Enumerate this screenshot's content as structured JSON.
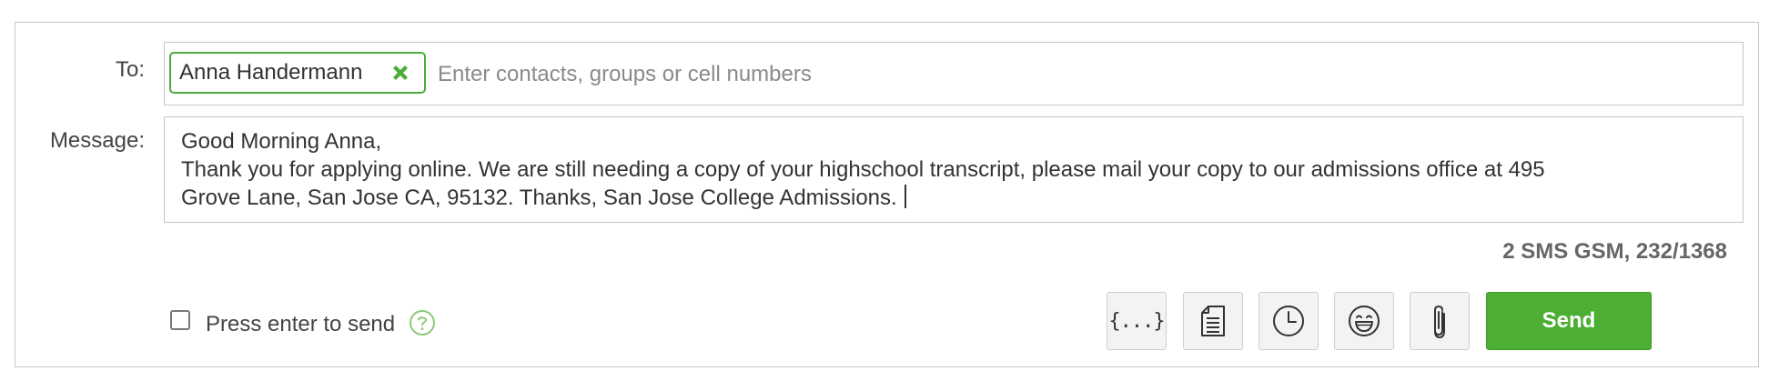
{
  "labels": {
    "to": "To:",
    "message": "Message:"
  },
  "recipients": [
    {
      "name": "Anna Handermann",
      "remove_icon": "close-x-icon"
    }
  ],
  "to_input": {
    "placeholder": "Enter contacts, groups or cell numbers",
    "value": ""
  },
  "message": {
    "lines": [
      "Good Morning Anna,",
      "Thank you for applying online. We are still needing a copy of your highschool transcript, please mail your copy to our admissions office at 495",
      "Grove Lane, San Jose CA, 95132. Thanks, San Jose College Admissions."
    ]
  },
  "counter": "2 SMS GSM, 232/1368",
  "press_enter": {
    "label": "Press enter to send",
    "checked": false,
    "help_icon": "question-circle-icon"
  },
  "toolbar": {
    "buttons": [
      {
        "icon": "merge-fields-icon",
        "text": "{...}"
      },
      {
        "icon": "template-document-icon"
      },
      {
        "icon": "clock-icon"
      },
      {
        "icon": "emoji-icon"
      },
      {
        "icon": "paperclip-icon"
      }
    ],
    "send_label": "Send"
  },
  "colors": {
    "accent": "#4cae33",
    "chip_border": "#4cab3a",
    "help_icon": "#8cc97a"
  }
}
